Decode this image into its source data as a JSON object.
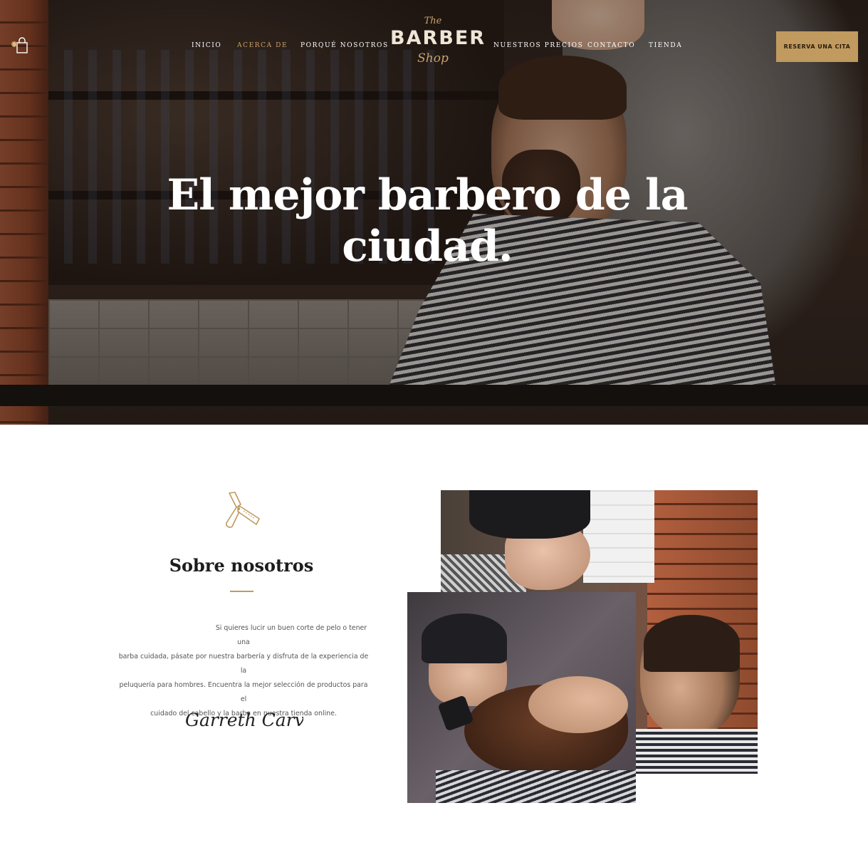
{
  "nav": {
    "items": [
      {
        "label": "Inicio",
        "active": false
      },
      {
        "label": "Acerca de",
        "active": true
      },
      {
        "label": "Porqué nosotros",
        "active": false
      },
      {
        "label": "Nuestros precios",
        "active": false
      },
      {
        "label": "Contacto",
        "active": false
      },
      {
        "label": "Tienda",
        "active": false
      }
    ],
    "cta_label": "Reserva una cita",
    "cart_icon": "shopping-bag-icon",
    "cart_count": "0"
  },
  "logo": {
    "the": "The",
    "barber": "BARBER",
    "shop": "Shop"
  },
  "hero": {
    "title_line1": "El mejor barbero de la",
    "title_line2": "ciudad."
  },
  "about": {
    "icon": "razor-icon",
    "title": "Sobre nosotros",
    "text_lines": [
      "Si quieres lucir un buen corte de pelo o tener una",
      "barba cuidada, pásate por nuestra barbería y disfruta de la experiencia de la",
      "peluquería para hombres. Encuentra la mejor selección de productos para el",
      "cuidado del cabello y la barba en nuestra tienda online."
    ],
    "signature": "Garreth Carver"
  },
  "colors": {
    "accent": "#c09a5e",
    "nav_active": "#c9a26a",
    "heading": "#1c1c1c",
    "body_text": "#555555"
  }
}
